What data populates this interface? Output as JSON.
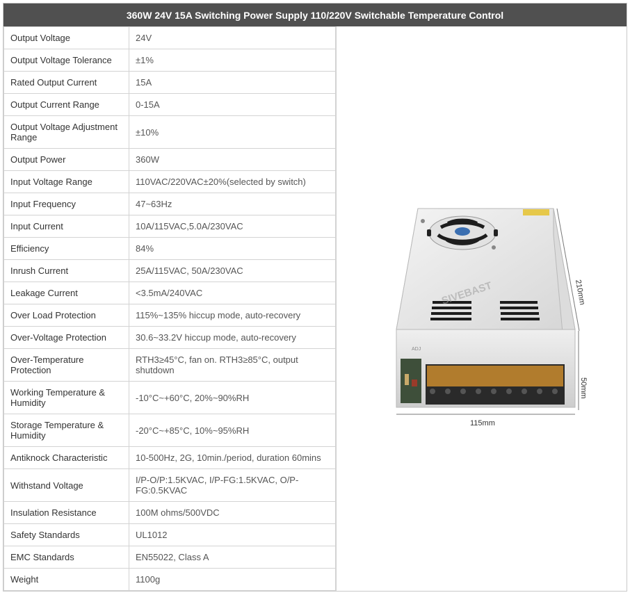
{
  "title": "360W 24V 15A Switching Power Supply 110/220V Switchable Temperature Control",
  "specs": [
    {
      "label": "Output Voltage",
      "value": "24V"
    },
    {
      "label": "Output Voltage Tolerance",
      "value": "±1%"
    },
    {
      "label": "Rated Output Current",
      "value": "15A"
    },
    {
      "label": "Output Current Range",
      "value": "0-15A"
    },
    {
      "label": "Output Voltage Adjustment Range",
      "value": "±10%"
    },
    {
      "label": "Output Power",
      "value": "360W"
    },
    {
      "label": "Input Voltage Range",
      "value": "110VAC/220VAC±20%(selected by switch)"
    },
    {
      "label": "Input Frequency",
      "value": "47~63Hz"
    },
    {
      "label": "Input Current",
      "value": "10A/115VAC,5.0A/230VAC"
    },
    {
      "label": "Efficiency",
      "value": "84%"
    },
    {
      "label": "Inrush Current",
      "value": "25A/115VAC, 50A/230VAC"
    },
    {
      "label": "Leakage Current",
      "value": "<3.5mA/240VAC"
    },
    {
      "label": "Over Load Protection",
      "value": "115%~135% hiccup mode, auto-recovery"
    },
    {
      "label": "Over-Voltage Protection",
      "value": "30.6~33.2V hiccup mode, auto-recovery"
    },
    {
      "label": "Over-Temperature Protection",
      "value": "RTH3≥45°C, fan on. RTH3≥85°C, output shutdown"
    },
    {
      "label": "Working Temperature & Humidity",
      "value": "-10°C~+60°C, 20%~90%RH"
    },
    {
      "label": "Storage Temperature & Humidity",
      "value": "-20°C~+85°C, 10%~95%RH"
    },
    {
      "label": "Antiknock Characteristic",
      "value": "10-500Hz, 2G, 10min./period, duration 60mins"
    },
    {
      "label": "Withstand Voltage",
      "value": "I/P-O/P:1.5KVAC, I/P-FG:1.5KVAC, O/P-FG:0.5KVAC"
    },
    {
      "label": "Insulation Resistance",
      "value": "100M ohms/500VDC"
    },
    {
      "label": "Safety Standards",
      "value": "UL1012"
    },
    {
      "label": "EMC Standards",
      "value": "EN55022, Class A"
    },
    {
      "label": "Weight",
      "value": "1100g"
    }
  ],
  "image": {
    "dim_length": "210mm",
    "dim_height": "50mm",
    "dim_width": "115mm",
    "brand_watermark": "SIVEBAST",
    "adj_label": "ADJ"
  }
}
